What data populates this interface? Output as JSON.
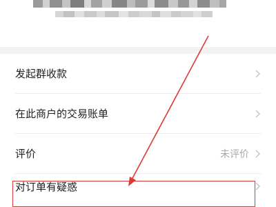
{
  "menu": {
    "items": [
      {
        "label": "发起群收款",
        "status": ""
      },
      {
        "label": "在此商户的交易账单",
        "status": ""
      },
      {
        "label": "评价",
        "status": "未评价"
      },
      {
        "label": "对订单有疑惑",
        "status": ""
      }
    ]
  },
  "colors": {
    "highlight": "#d93a36",
    "separator": "#f2f2f2",
    "secondary_text": "#a8a8a8"
  },
  "annotation": {
    "highlighted_item": "对订单有疑惑"
  }
}
